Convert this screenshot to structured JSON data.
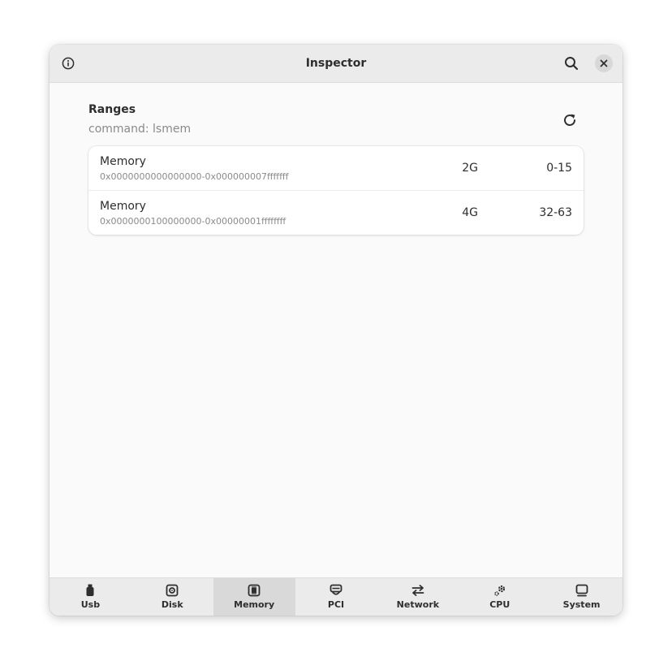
{
  "window": {
    "title": "Inspector"
  },
  "section": {
    "title": "Ranges",
    "subtitle": "command: lsmem"
  },
  "ranges": [
    {
      "title": "Memory",
      "range": "0x0000000000000000-0x000000007fffffff",
      "size": "2G",
      "nodes": "0-15"
    },
    {
      "title": "Memory",
      "range": "0x0000000100000000-0x00000001ffffffff",
      "size": "4G",
      "nodes": "32-63"
    }
  ],
  "tabs": [
    {
      "label": "Usb",
      "icon": "usb-icon",
      "active": false
    },
    {
      "label": "Disk",
      "icon": "disk-icon",
      "active": false
    },
    {
      "label": "Memory",
      "icon": "memory-icon",
      "active": true
    },
    {
      "label": "PCI",
      "icon": "pci-icon",
      "active": false
    },
    {
      "label": "Network",
      "icon": "network-icon",
      "active": false
    },
    {
      "label": "CPU",
      "icon": "cpu-icon",
      "active": false
    },
    {
      "label": "System",
      "icon": "system-icon",
      "active": false
    }
  ],
  "colors": {
    "text": "#2e2e2e",
    "dim_text": "#8a8a8a",
    "headerbar": "#ebebeb",
    "active_tab": "#d9d9d9"
  }
}
